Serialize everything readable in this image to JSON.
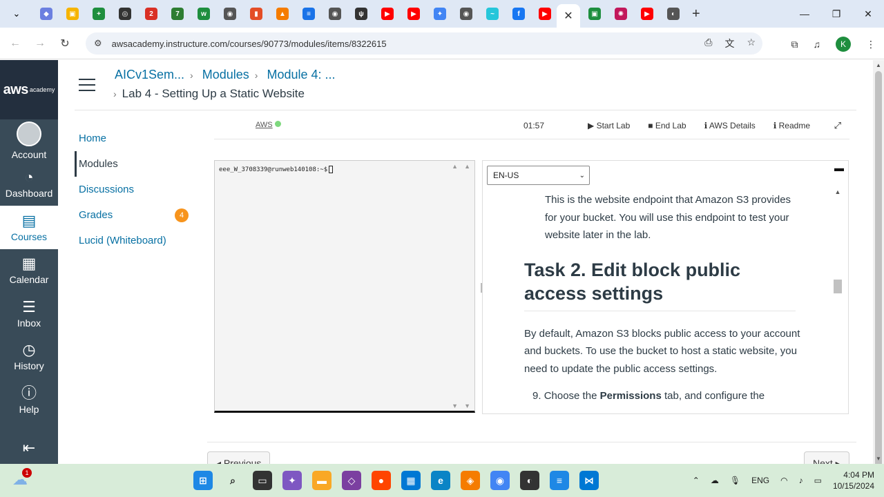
{
  "browser": {
    "active_tab_close": "✕",
    "new_tab": "+",
    "url": "awsacademy.instructure.com/courses/90773/modules/items/8322615",
    "profile_initial": "K",
    "tab_favicons": [
      {
        "name": "tab-1",
        "color": "#6b7fe0",
        "glyph": "◆"
      },
      {
        "name": "tab-2",
        "color": "#f6b400",
        "glyph": "▣"
      },
      {
        "name": "tab-3",
        "color": "#1e8e3e",
        "glyph": "+"
      },
      {
        "name": "tab-4",
        "color": "#333333",
        "glyph": "◎"
      },
      {
        "name": "tab-5",
        "color": "#d93025",
        "glyph": "2"
      },
      {
        "name": "tab-6",
        "color": "#2e7d32",
        "glyph": "7"
      },
      {
        "name": "tab-7",
        "color": "#1e8e3e",
        "glyph": "w"
      },
      {
        "name": "tab-8",
        "color": "#555555",
        "glyph": "◉"
      },
      {
        "name": "tab-9",
        "color": "#e44d26",
        "glyph": "▮"
      },
      {
        "name": "tab-10",
        "color": "#f57c00",
        "glyph": "▲"
      },
      {
        "name": "tab-11",
        "color": "#1a73e8",
        "glyph": "≡"
      },
      {
        "name": "tab-12",
        "color": "#555555",
        "glyph": "◉"
      },
      {
        "name": "tab-13",
        "color": "#333333",
        "glyph": "ψ"
      },
      {
        "name": "tab-14",
        "color": "#ff0000",
        "glyph": "▶"
      },
      {
        "name": "tab-15",
        "color": "#ff0000",
        "glyph": "▶"
      },
      {
        "name": "tab-16",
        "color": "#4285f4",
        "glyph": "✦"
      },
      {
        "name": "tab-17",
        "color": "#555555",
        "glyph": "◉"
      },
      {
        "name": "tab-18",
        "color": "#26c6da",
        "glyph": "~"
      },
      {
        "name": "tab-19",
        "color": "#1877f2",
        "glyph": "f"
      },
      {
        "name": "tab-20",
        "color": "#ff0000",
        "glyph": "▶"
      }
    ],
    "tab_favicons_after": [
      {
        "name": "tab-22",
        "color": "#1e8e3e",
        "glyph": "▣"
      },
      {
        "name": "tab-23",
        "color": "#c2185b",
        "glyph": "✺"
      },
      {
        "name": "tab-24",
        "color": "#ff0000",
        "glyph": "▶"
      },
      {
        "name": "tab-25",
        "color": "#555555",
        "glyph": "◐"
      }
    ]
  },
  "canvas_nav": {
    "logo_text": "aws",
    "logo_sub": "academy",
    "items": [
      {
        "label": "Account",
        "icon": "user-avatar"
      },
      {
        "label": "Dashboard",
        "icon": "speedometer-icon"
      },
      {
        "label": "Courses",
        "icon": "book-icon"
      },
      {
        "label": "Calendar",
        "icon": "calendar-icon"
      },
      {
        "label": "Inbox",
        "icon": "inbox-icon"
      },
      {
        "label": "History",
        "icon": "clock-icon"
      },
      {
        "label": "Help",
        "icon": "help-icon"
      }
    ]
  },
  "breadcrumb": {
    "course": "AICv1Sem...",
    "modules": "Modules",
    "module": "Module 4: ...",
    "current": "Lab 4 - Setting Up a Static Website"
  },
  "course_nav": {
    "home": "Home",
    "modules": "Modules",
    "discussions": "Discussions",
    "grades": "Grades",
    "grades_badge": "4",
    "lucid": "Lucid (Whiteboard)"
  },
  "lab_toolbar": {
    "aws_label": "AWS",
    "status_color": "#7ed87e",
    "timer": "01:57",
    "start_lab": "Start Lab",
    "end_lab": "End Lab",
    "aws_details": "AWS Details",
    "readme": "Readme"
  },
  "terminal": {
    "prompt": "eee_W_3708339@runweb140108:~$"
  },
  "readme": {
    "language": "EN-US",
    "intro": "This is the website endpoint that Amazon S3 provides for your bucket. You will use this endpoint to test your website later in the lab.",
    "heading": "Task 2. Edit block public access settings",
    "paragraph": "By default, Amazon S3 blocks public access to your account and buckets. To use the bucket to host a static website, you need to update the public access settings.",
    "step_number": "9.",
    "step_prefix": "Choose the",
    "step_bold": "Permissions",
    "step_suffix": "tab, and configure the"
  },
  "pager": {
    "previous": "◂ Previous",
    "next": "Next ▸"
  },
  "taskbar": {
    "weather_badge": "1",
    "language": "ENG",
    "time": "4:04 PM",
    "date": "10/15/2024"
  }
}
